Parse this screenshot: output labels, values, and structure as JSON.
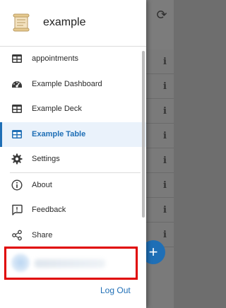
{
  "app": {
    "name": "example"
  },
  "nav": {
    "items": [
      {
        "label": "appointments",
        "icon": "table-icon",
        "active": false
      },
      {
        "label": "Example Dashboard",
        "icon": "dashboard-gauge-icon",
        "active": false
      },
      {
        "label": "Example Deck",
        "icon": "table-icon",
        "active": false
      },
      {
        "label": "Example Table",
        "icon": "table-icon",
        "active": true
      },
      {
        "label": "Settings",
        "icon": "gear-icon",
        "active": false
      },
      {
        "label": "About",
        "icon": "info-icon",
        "active": false
      },
      {
        "label": "Feedback",
        "icon": "feedback-icon",
        "active": false
      },
      {
        "label": "Share",
        "icon": "share-icon",
        "active": false
      }
    ]
  },
  "footer": {
    "logout_label": "Log Out"
  },
  "colors": {
    "accent": "#1f6fb6",
    "highlight_box": "#e00000"
  }
}
